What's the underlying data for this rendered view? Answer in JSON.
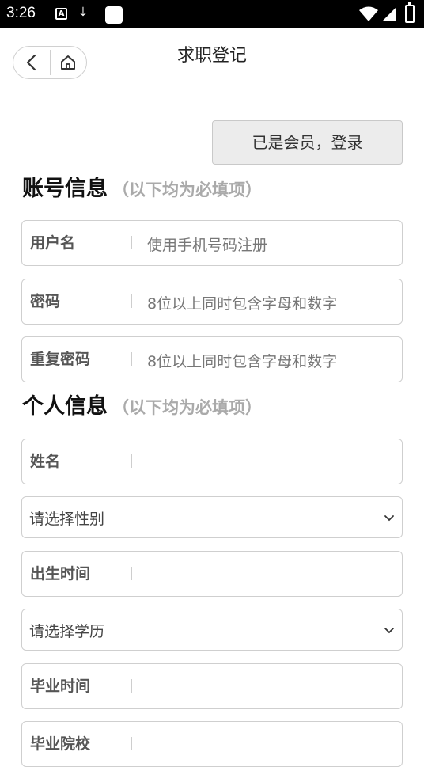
{
  "status": {
    "time": "3:26",
    "a_badge": "A",
    "download_glyph": "⤓"
  },
  "nav": {
    "back_icon": "chevron-left-icon",
    "home_icon": "home-icon"
  },
  "page": {
    "title": "求职登记"
  },
  "login_button": "已是会员，登录",
  "account_section": {
    "title": "账号信息",
    "hint": "（以下均为必填项）"
  },
  "account_fields": [
    {
      "label": "用户名",
      "sep": "|",
      "placeholder": "使用手机号码注册"
    },
    {
      "label": "密码",
      "sep": "|",
      "placeholder": "8位以上同时包含字母和数字"
    },
    {
      "label": "重复密码",
      "sep": "|",
      "placeholder": "8位以上同时包含字母和数字"
    }
  ],
  "personal_section": {
    "title": "个人信息",
    "hint": "（以下均为必填项）"
  },
  "personal_fields": {
    "name": {
      "label": "姓名",
      "sep": "|"
    },
    "gender_select": "请选择性别",
    "birth": {
      "label": "出生时间",
      "sep": "|"
    },
    "education_select": "请选择学历",
    "grad_time": {
      "label": "毕业时间",
      "sep": "|"
    },
    "school": {
      "label": "毕业院校",
      "sep": "|"
    }
  }
}
